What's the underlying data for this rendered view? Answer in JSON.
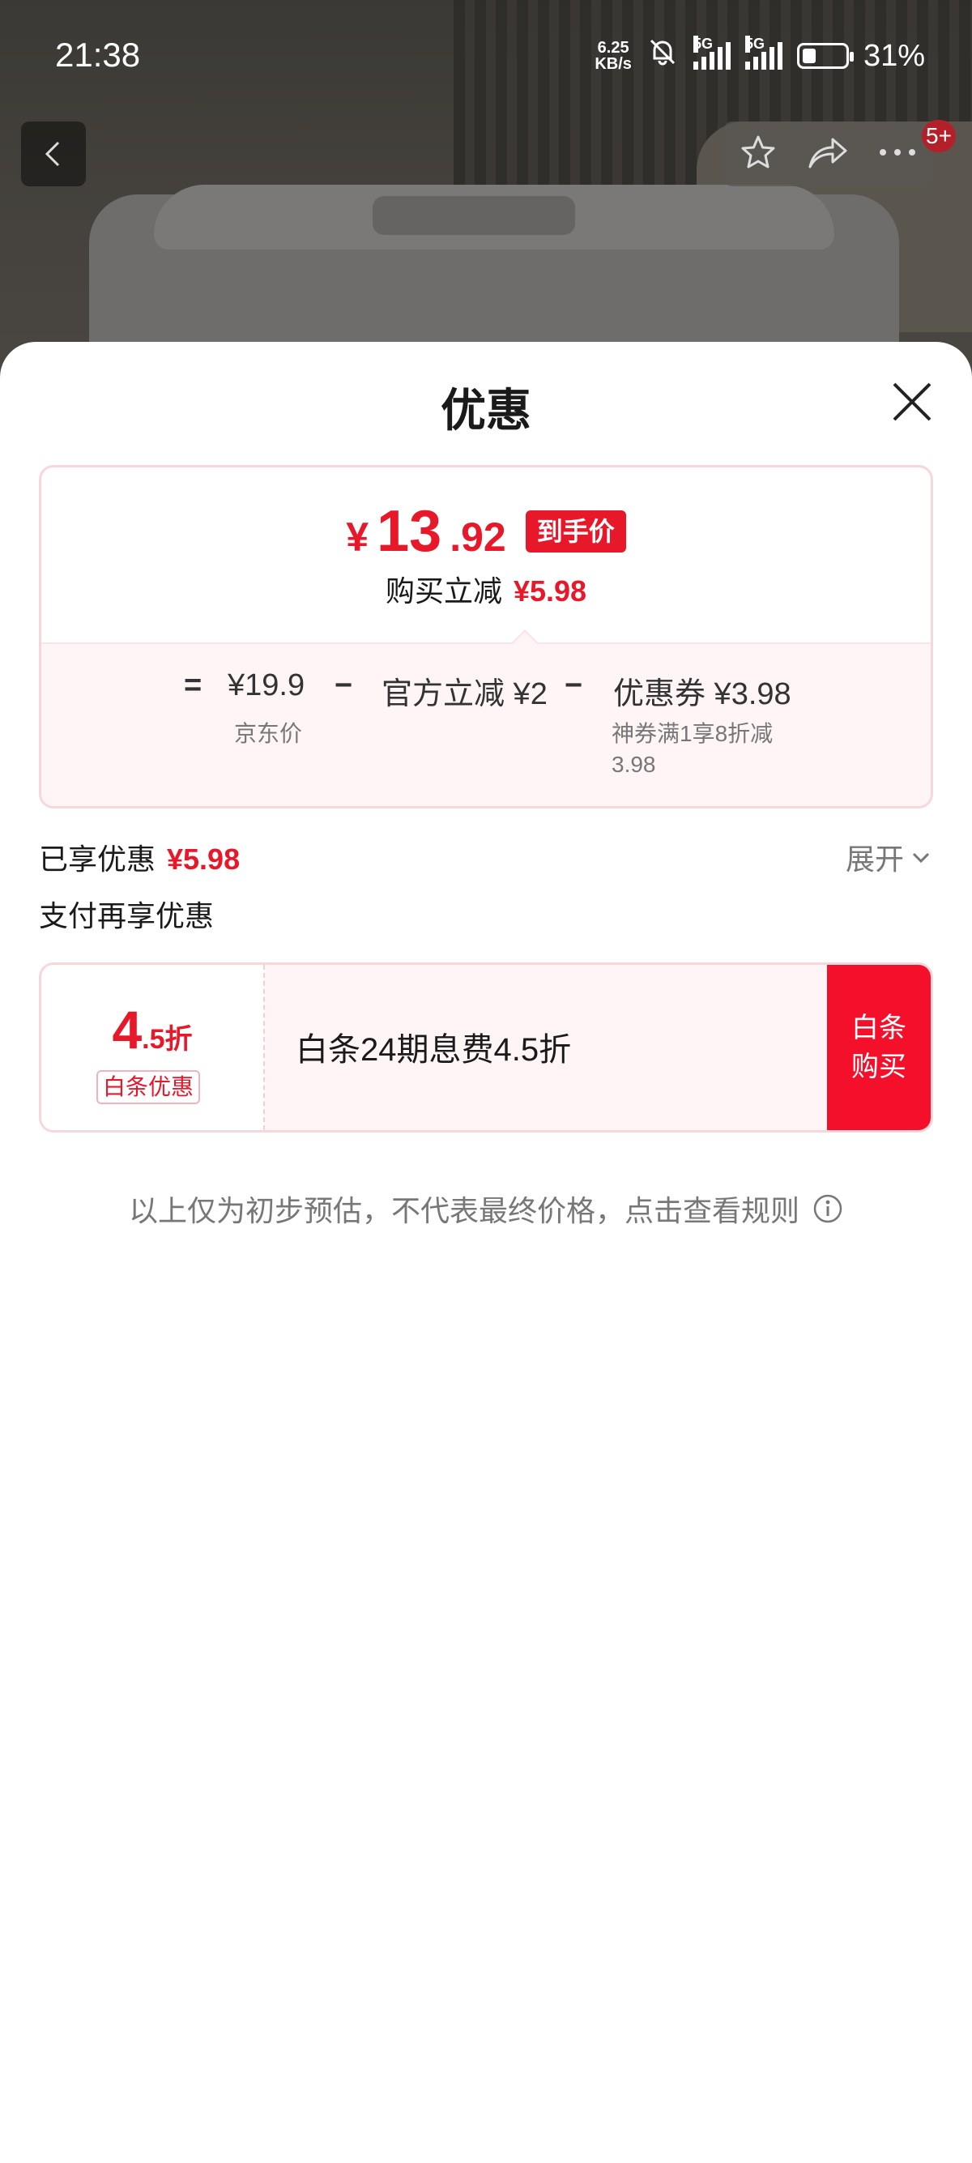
{
  "status_bar": {
    "time": "21:38",
    "net_speed_value": "6.25",
    "net_speed_unit": "KB/s",
    "sim1_label": "5G",
    "sim2_label": "5G",
    "battery_percent": "31%",
    "battery_level": 0.31
  },
  "top_nav": {
    "badge": "5+"
  },
  "sheet": {
    "title": "优惠"
  },
  "price_card": {
    "currency": "¥",
    "price_integer": "13",
    "price_decimal": ".92",
    "price_tag": "到手价",
    "reduce_label": "购买立减",
    "reduce_amount": "¥5.98",
    "equals": "=",
    "jd_price": "¥19.9",
    "jd_price_label": "京东价",
    "minus1": "−",
    "official_reduce": "官方立减 ¥2",
    "minus2": "−",
    "coupon": "优惠券 ¥3.98",
    "coupon_desc_line1": "神券满1享8折减",
    "coupon_desc_line2": "3.98"
  },
  "enjoyed": {
    "label": "已享优惠",
    "amount": "¥5.98",
    "expand_label": "展开"
  },
  "pay": {
    "title": "支付再享优惠",
    "discount_big": "4",
    "discount_small": ".5折",
    "tag": "白条优惠",
    "desc": "白条24期息费4.5折",
    "buy_line1": "白条",
    "buy_line2": "购买"
  },
  "note": {
    "text": "以上仅为初步预估，不代表最终价格，点击查看规则"
  },
  "colors": {
    "accent": "#e8182b",
    "card_border": "#f6d8dc",
    "card_tint": "#fff5f6"
  }
}
